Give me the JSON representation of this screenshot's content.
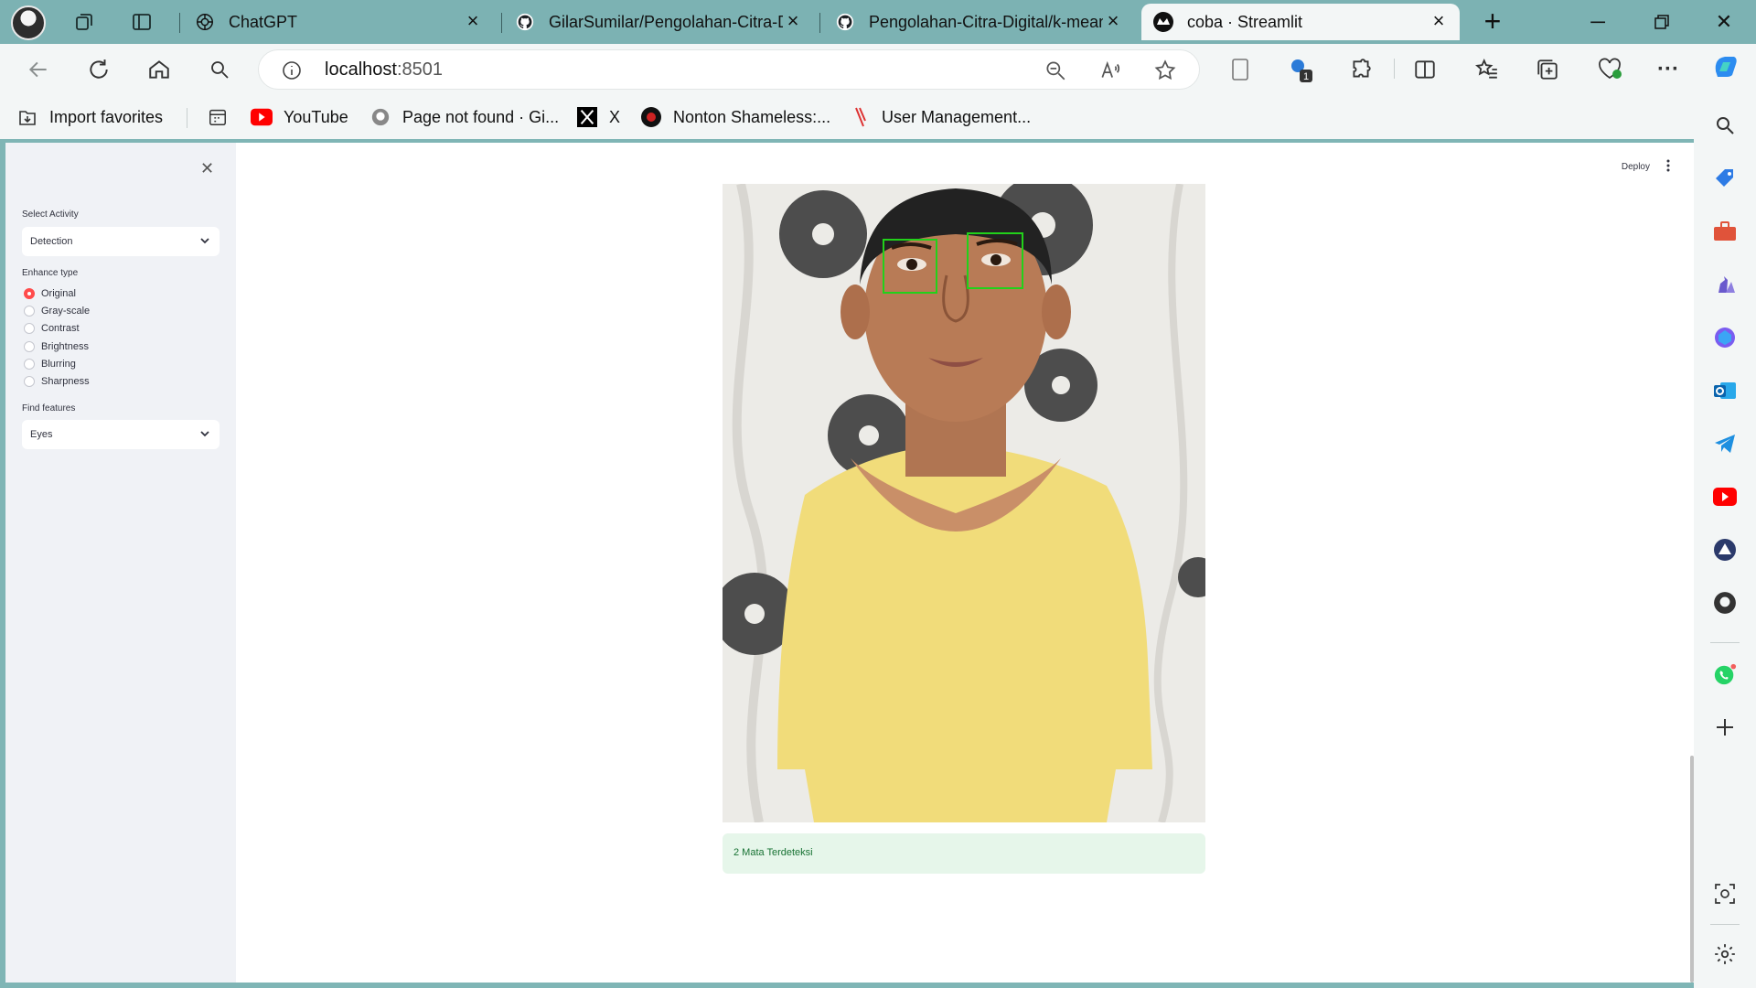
{
  "browser": {
    "tabs": [
      {
        "title": "ChatGPT",
        "icon": "chatgpt-icon"
      },
      {
        "title": "GilarSumilar/Pengolahan-Citra-Digital",
        "icon": "github-icon"
      },
      {
        "title": "Pengolahan-Citra-Digital/k-means",
        "icon": "github-icon"
      },
      {
        "title": "coba · Streamlit",
        "icon": "streamlit-icon",
        "active": true
      }
    ],
    "address": {
      "host": "localhost",
      "port": ":8501"
    },
    "bookmarks": [
      {
        "label": "Import favorites",
        "icon": "import-icon"
      },
      {
        "label": "YouTube",
        "icon": "youtube-icon"
      },
      {
        "label": "Page not found · Gi...",
        "icon": "github-icon"
      },
      {
        "label": "X",
        "icon": "x-icon"
      },
      {
        "label": "Nonton Shameless:...",
        "icon": "site-icon"
      },
      {
        "label": "User Management...",
        "icon": "ribbon-icon"
      }
    ],
    "extension_badge": "1"
  },
  "app": {
    "deploy_label": "Deploy",
    "sidebar": {
      "activity_label": "Select Activity",
      "activity_value": "Detection",
      "enhance_label": "Enhance type",
      "enhance_options": [
        "Original",
        "Gray-scale",
        "Contrast",
        "Brightness",
        "Blurring",
        "Sharpness"
      ],
      "enhance_selected": "Original",
      "features_label": "Find features",
      "features_value": "Eyes"
    },
    "result_message": "2 Mata Terdeteksi",
    "detections": 2
  },
  "colors": {
    "accent": "#ff4b4b",
    "success_bg": "#e6f6ea",
    "success_text": "#177233",
    "detection_box": "#22d11a",
    "tabstrip": "#7cb2b3"
  }
}
